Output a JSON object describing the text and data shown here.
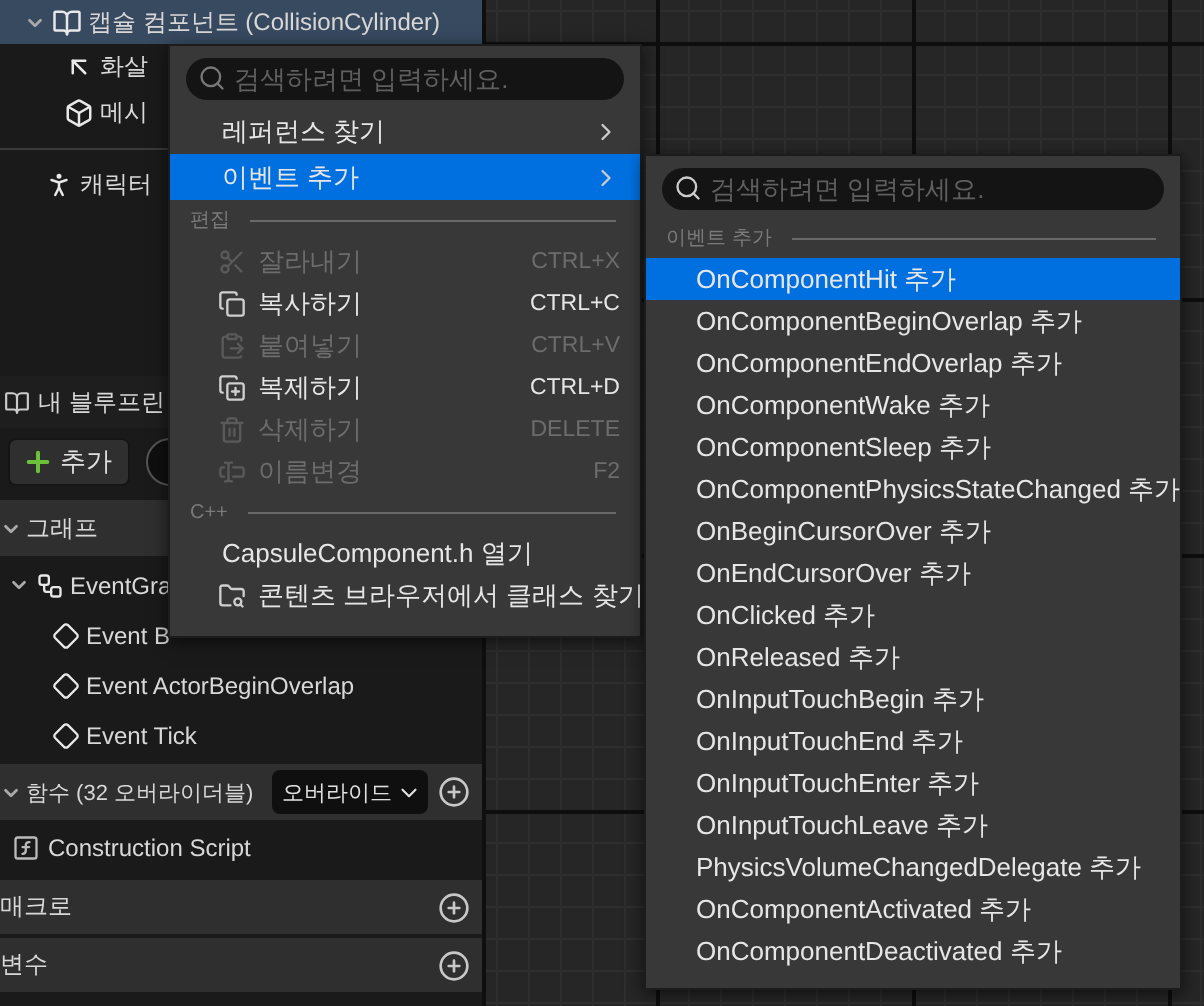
{
  "components_tree": [
    {
      "label": "캡슐 컴포넌트 (CollisionCylinder)",
      "selected": true,
      "expanded": true,
      "kind": "capsule"
    },
    {
      "label": "화살",
      "selected": false,
      "kind": "arrow"
    },
    {
      "label": "메시",
      "selected": false,
      "kind": "mesh"
    },
    {
      "label": "캐릭터",
      "selected": false,
      "kind": "character"
    }
  ],
  "my_blueprint": {
    "title": "내 블루프린",
    "add_button": "추가",
    "sections": [
      {
        "title": "그래프",
        "expanded": true,
        "items": [
          {
            "label": "EventGra",
            "kind": "graph",
            "expanded": true,
            "children": [
              {
                "label": "Event B",
                "kind": "event"
              },
              {
                "label": "Event ActorBeginOverlap",
                "kind": "event"
              },
              {
                "label": "Event Tick",
                "kind": "event"
              }
            ]
          }
        ]
      },
      {
        "title": "함수 (32 오버라이더블)",
        "expanded": true,
        "dropdown": "오버라이드",
        "items": [
          {
            "label": "Construction Script",
            "kind": "function"
          }
        ]
      },
      {
        "title": "매크로"
      },
      {
        "title": "변수"
      }
    ]
  },
  "context_menu": {
    "search_placeholder": "검색하려면 입력하세요.",
    "groups": [
      {
        "items": [
          {
            "label": "레퍼런스 찾기",
            "submenu": true,
            "selected": false
          },
          {
            "label": "이벤트 추가",
            "submenu": true,
            "selected": true
          }
        ]
      },
      {
        "heading": "편집",
        "items": [
          {
            "label": "잘라내기",
            "shortcut": "CTRL+X",
            "disabled": true,
            "kind": "cut"
          },
          {
            "label": "복사하기",
            "shortcut": "CTRL+C",
            "disabled": false,
            "kind": "copy"
          },
          {
            "label": "붙여넣기",
            "shortcut": "CTRL+V",
            "disabled": true,
            "kind": "paste"
          },
          {
            "label": "복제하기",
            "shortcut": "CTRL+D",
            "disabled": false,
            "kind": "duplicate"
          },
          {
            "label": "삭제하기",
            "shortcut": "DELETE",
            "disabled": true,
            "kind": "delete"
          },
          {
            "label": "이름변경",
            "shortcut": "F2",
            "disabled": true,
            "kind": "rename"
          }
        ]
      },
      {
        "heading": "C++",
        "items": [
          {
            "label": "CapsuleComponent.h 열기",
            "disabled": false
          },
          {
            "label": "콘텐츠 브라우저에서 클래스 찾기",
            "disabled": false,
            "kind": "browse"
          }
        ]
      }
    ]
  },
  "event_submenu": {
    "search_placeholder": "검색하려면 입력하세요.",
    "heading": "이벤트 추가",
    "items": [
      {
        "label": "OnComponentHit 추가",
        "selected": true
      },
      {
        "label": "OnComponentBeginOverlap 추가",
        "selected": false
      },
      {
        "label": "OnComponentEndOverlap 추가",
        "selected": false
      },
      {
        "label": "OnComponentWake 추가",
        "selected": false
      },
      {
        "label": "OnComponentSleep 추가",
        "selected": false
      },
      {
        "label": "OnComponentPhysicsStateChanged 추가",
        "selected": false
      },
      {
        "label": "OnBeginCursorOver 추가",
        "selected": false
      },
      {
        "label": "OnEndCursorOver 추가",
        "selected": false
      },
      {
        "label": "OnClicked 추가",
        "selected": false
      },
      {
        "label": "OnReleased 추가",
        "selected": false
      },
      {
        "label": "OnInputTouchBegin 추가",
        "selected": false
      },
      {
        "label": "OnInputTouchEnd 추가",
        "selected": false
      },
      {
        "label": "OnInputTouchEnter 추가",
        "selected": false
      },
      {
        "label": "OnInputTouchLeave 추가",
        "selected": false
      },
      {
        "label": "PhysicsVolumeChangedDelegate 추가",
        "selected": false
      },
      {
        "label": "OnComponentActivated 추가",
        "selected": false
      },
      {
        "label": "OnComponentDeactivated 추가",
        "selected": false
      }
    ]
  }
}
